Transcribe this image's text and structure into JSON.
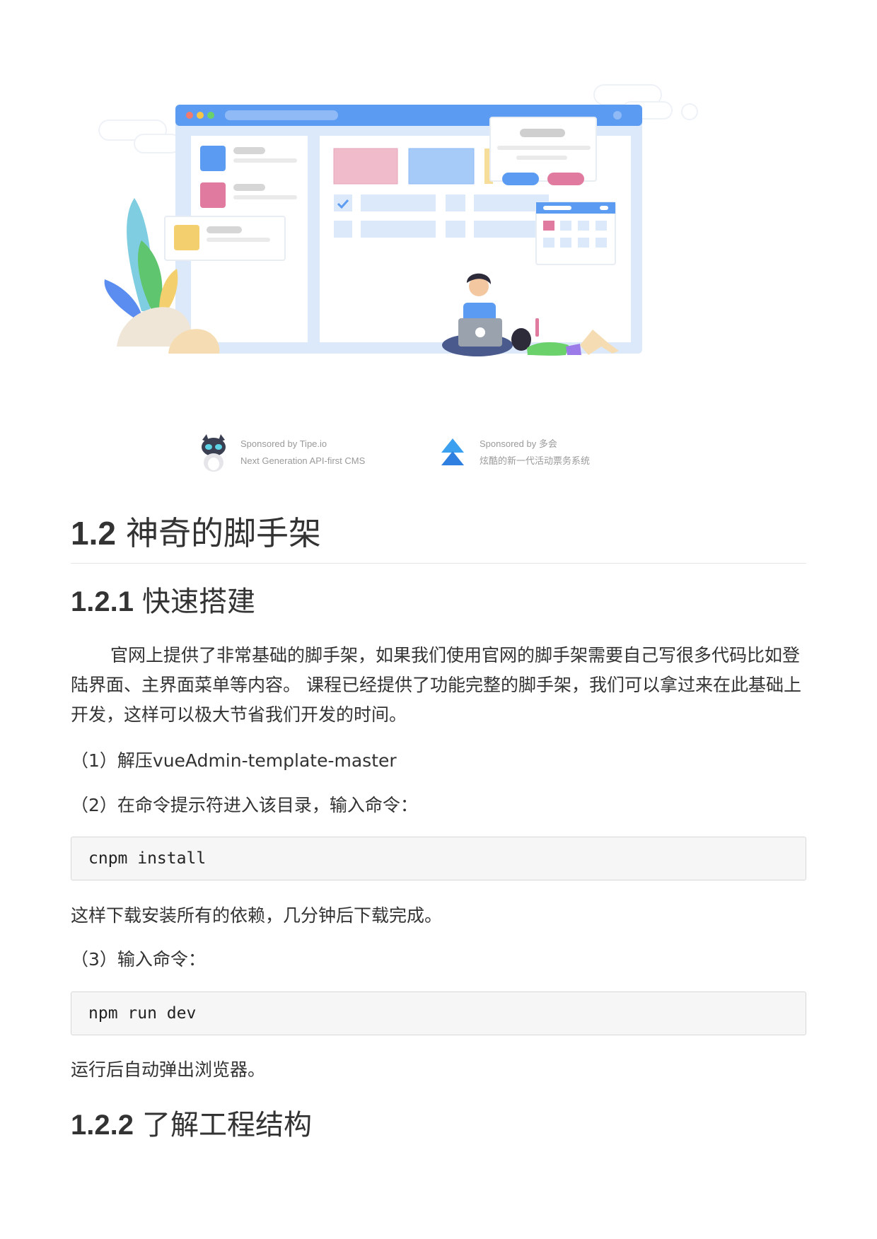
{
  "sponsors": [
    {
      "line1": "Sponsored by Tipe.io",
      "line2": "Next Generation API-first CMS",
      "logo_icon": "tipe-cat-logo-icon"
    },
    {
      "line1": "Sponsored by 多会",
      "line2": "炫酷的新一代活动票务系统",
      "logo_icon": "duohui-arrow-logo-icon"
    }
  ],
  "section": {
    "number": "1.2",
    "title": "神奇的脚手架"
  },
  "sub1": {
    "number": "1.2.1",
    "title": "快速搭建"
  },
  "para1": "官网上提供了非常基础的脚手架，如果我们使用官网的脚手架需要自己写很多代码比如登陆界面、主界面菜单等内容。 课程已经提供了功能完整的脚手架，我们可以拿过来在此基础上开发，这样可以极大节省我们开发的时间。",
  "step1": "（1）解压vueAdmin-template-master",
  "step2": "（2）在命令提示符进入该目录，输入命令：",
  "code1": "cnpm install",
  "desc1": "这样下载安装所有的依赖，几分钟后下载完成。",
  "step3": "（3）输入命令：",
  "code2": "npm run dev",
  "desc2": "运行后自动弹出浏览器。",
  "sub2": {
    "number": "1.2.2",
    "title": "了解工程结构"
  },
  "colors": {
    "blue": "#5b9cf2",
    "pink": "#e8a2b8",
    "yellow": "#f3cf6d",
    "text": "#333333"
  }
}
